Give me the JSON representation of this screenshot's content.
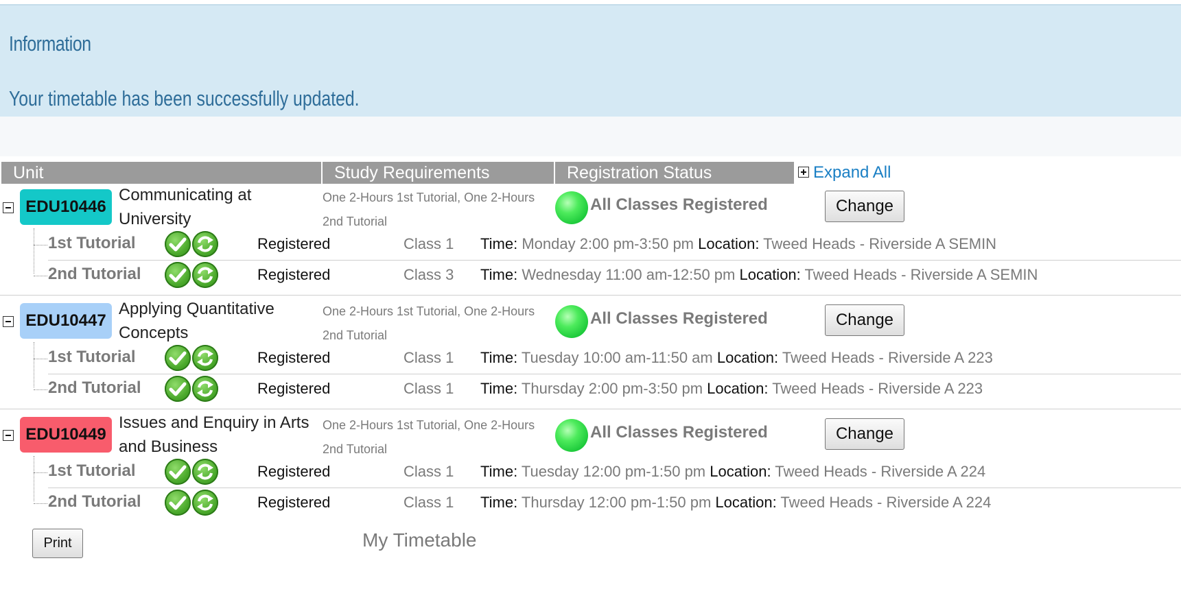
{
  "info": {
    "title": "Information",
    "message": "Your timetable has been successfully updated."
  },
  "table": {
    "headers": {
      "unit": "Unit",
      "study_requirements": "Study Requirements",
      "registration_status": "Registration Status"
    },
    "expand_all": "Expand All"
  },
  "units": [
    {
      "code": "EDU10446",
      "code_color": "#14c8c8",
      "name": "Communicating at University",
      "requirements": "One 2-Hours 1st Tutorial, One 2-Hours 2nd Tutorial",
      "status": "All Classes Registered",
      "change_label": "Change",
      "classes": [
        {
          "type": "1st Tutorial",
          "registered": "Registered",
          "class": "Class 1",
          "time_label": "Time:",
          "time": "Monday 2:00 pm-3:50 pm",
          "location_label": "Location:",
          "location": "Tweed Heads - Riverside A SEMIN"
        },
        {
          "type": "2nd Tutorial",
          "registered": "Registered",
          "class": "Class 3",
          "time_label": "Time:",
          "time": "Wednesday 11:00 am-12:50 pm",
          "location_label": "Location:",
          "location": "Tweed Heads - Riverside A SEMIN"
        }
      ]
    },
    {
      "code": "EDU10447",
      "code_color": "#a8d0f8",
      "name": "Applying Quantitative Concepts",
      "requirements": "One 2-Hours 1st Tutorial, One 2-Hours 2nd Tutorial",
      "status": "All Classes Registered",
      "change_label": "Change",
      "classes": [
        {
          "type": "1st Tutorial",
          "registered": "Registered",
          "class": "Class 1",
          "time_label": "Time:",
          "time": "Tuesday 10:00 am-11:50 am",
          "location_label": "Location:",
          "location": "Tweed Heads - Riverside A 223"
        },
        {
          "type": "2nd Tutorial",
          "registered": "Registered",
          "class": "Class 1",
          "time_label": "Time:",
          "time": "Thursday 2:00 pm-3:50 pm",
          "location_label": "Location:",
          "location": "Tweed Heads - Riverside A 223"
        }
      ]
    },
    {
      "code": "EDU10449",
      "code_color": "#f85c6c",
      "name": "Issues and Enquiry in Arts and Business",
      "requirements": "One 2-Hours 1st Tutorial, One 2-Hours 2nd Tutorial",
      "status": "All Classes Registered",
      "change_label": "Change",
      "classes": [
        {
          "type": "1st Tutorial",
          "registered": "Registered",
          "class": "Class 1",
          "time_label": "Time:",
          "time": "Tuesday 12:00 pm-1:50 pm",
          "location_label": "Location:",
          "location": "Tweed Heads - Riverside A 224"
        },
        {
          "type": "2nd Tutorial",
          "registered": "Registered",
          "class": "Class 1",
          "time_label": "Time:",
          "time": "Thursday 12:00 pm-1:50 pm",
          "location_label": "Location:",
          "location": "Tweed Heads - Riverside A 224"
        }
      ]
    }
  ],
  "footer": {
    "print_label": "Print",
    "caption": "My Timetable"
  }
}
